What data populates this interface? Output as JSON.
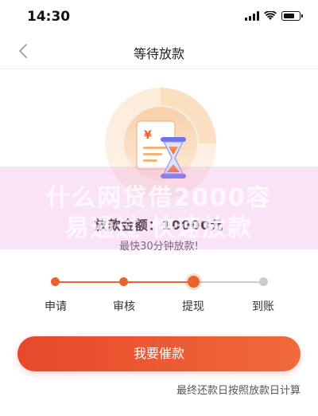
{
  "status_bar": {
    "time": "14:30"
  },
  "nav": {
    "title": "等待放款"
  },
  "illustration": {
    "currency_symbol": "¥"
  },
  "amount": {
    "text": "放款金额：10000元"
  },
  "hint": {
    "text": "最快30分钟放款!"
  },
  "watermark": {
    "line1": "什么网贷借2000容",
    "line2": "易通过 快速放款"
  },
  "steps": [
    {
      "label": "申请",
      "state": "done"
    },
    {
      "label": "审核",
      "state": "done"
    },
    {
      "label": "提现",
      "state": "current"
    },
    {
      "label": "到账",
      "state": "pending"
    }
  ],
  "colors": {
    "accent": "#e8632e",
    "pending": "#cccccc",
    "button_start": "#e8482b",
    "button_end": "#f06a3a"
  },
  "cta": {
    "label": "我要催款"
  },
  "footnote": {
    "text": "最终还款日按照放款日计算"
  }
}
